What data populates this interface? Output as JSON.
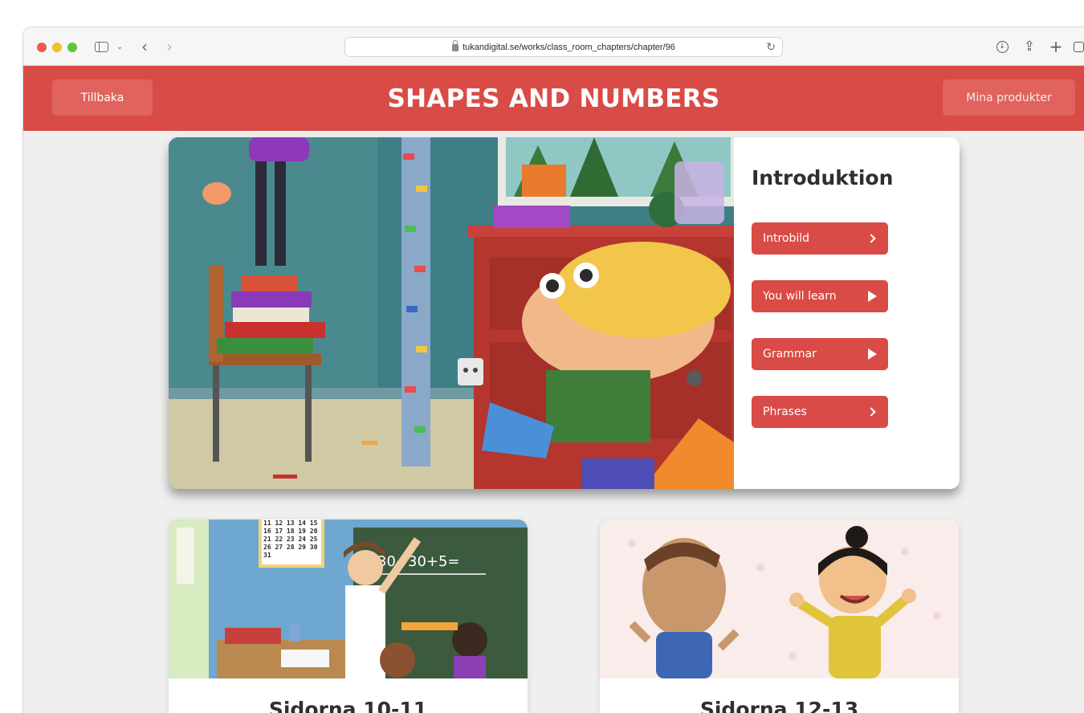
{
  "browser": {
    "url": "tukandigital.se/works/class_room_chapters/chapter/96"
  },
  "header": {
    "title": "SHAPES AND NUMBERS",
    "back_label": "Tillbaka",
    "products_label": "Mina produkter",
    "color": "#d94b46"
  },
  "intro": {
    "heading": "Introduktion",
    "buttons": [
      {
        "label": "Introbild",
        "icon": "chevron-right-icon"
      },
      {
        "label": "You will learn",
        "icon": "play-icon"
      },
      {
        "label": "Grammar",
        "icon": "play-icon"
      },
      {
        "label": "Phrases",
        "icon": "chevron-right-icon"
      }
    ]
  },
  "chapters": [
    {
      "title": "Sidorna 10-11",
      "board_text": "30+30+5=",
      "calendar": [
        "11 12 13 14 15",
        "16 17 18 19 20",
        "21 22 23 24 25",
        "26 27 28 29 30",
        "31"
      ]
    },
    {
      "title": "Sidorna 12-13"
    }
  ]
}
